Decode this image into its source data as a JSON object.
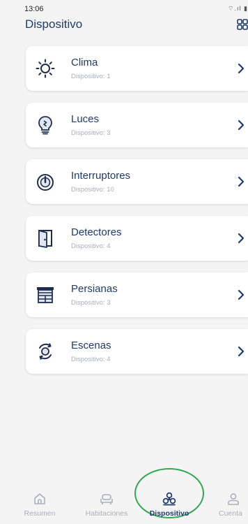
{
  "status": {
    "time": "13:06",
    "icons": "⌔.ıl ▮"
  },
  "header": {
    "title": "Dispositivo"
  },
  "devices": [
    {
      "title": "Clima",
      "subtitle": "Dispositivo: 1",
      "icon": "sun-icon"
    },
    {
      "title": "Luces",
      "subtitle": "Dispositivo: 3",
      "icon": "lightbulb-icon"
    },
    {
      "title": "Interruptores",
      "subtitle": "Dispositivo: 10",
      "icon": "power-icon"
    },
    {
      "title": "Detectores",
      "subtitle": "Dispositivo: 4",
      "icon": "door-sensor-icon"
    },
    {
      "title": "Persianas",
      "subtitle": "Dispositivo: 3",
      "icon": "blinds-icon"
    },
    {
      "title": "Escenas",
      "subtitle": "Dispositivo: 4",
      "icon": "scenes-icon"
    }
  ],
  "nav": [
    {
      "label": "Resumen",
      "icon": "home-icon",
      "active": false
    },
    {
      "label": "Habitaciones",
      "icon": "sofa-icon",
      "active": false
    },
    {
      "label": "Dispositivo",
      "icon": "fan-icon",
      "active": true
    },
    {
      "label": "Cuenta",
      "icon": "user-icon",
      "active": false
    }
  ],
  "colors": {
    "primary": "#1f3a6b",
    "accent_ring": "#2fa84f",
    "muted": "#a9afb8",
    "background": "#f4f4f4"
  }
}
